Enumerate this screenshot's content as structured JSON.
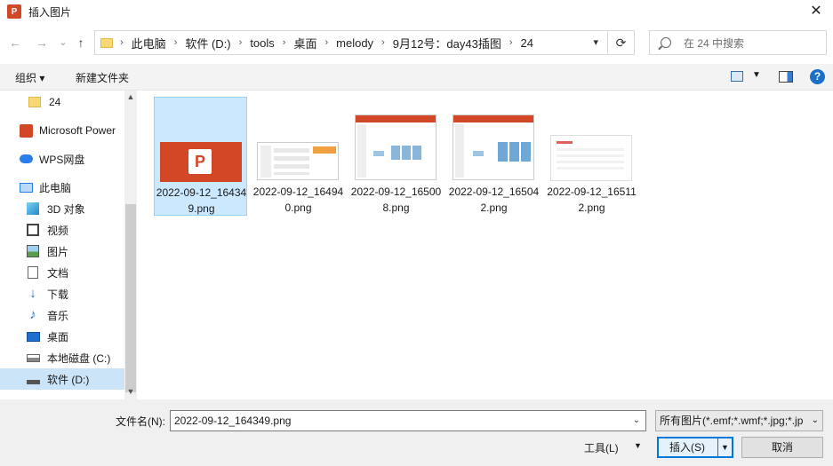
{
  "window": {
    "title": "插入图片",
    "app_icon_letter": "P",
    "close_glyph": "✕"
  },
  "nav": {
    "back_glyph": "←",
    "forward_glyph": "→",
    "recent_glyph": "⌄",
    "up_glyph": "↑",
    "breadcrumbs": [
      "此电脑",
      "软件 (D:)",
      "tools",
      "桌面",
      "melody",
      "9月12号：day43插图",
      "24"
    ],
    "crumb_separator": "›",
    "refresh_glyph": "⟳",
    "search_placeholder": "在 24 中搜索"
  },
  "toolbar": {
    "organize_label": "组织 ▾",
    "new_folder_label": "新建文件夹"
  },
  "sidebar": {
    "items": [
      {
        "label": "24",
        "icon": "folder-icon"
      },
      {
        "label": "Microsoft Power",
        "icon": "powerpoint-icon"
      },
      {
        "label": "WPS网盘",
        "icon": "cloud-icon"
      },
      {
        "label": "此电脑",
        "icon": "computer-icon"
      },
      {
        "label": "3D 对象",
        "icon": "cube-icon"
      },
      {
        "label": "视频",
        "icon": "video-icon"
      },
      {
        "label": "图片",
        "icon": "pictures-icon"
      },
      {
        "label": "文档",
        "icon": "documents-icon"
      },
      {
        "label": "下载",
        "icon": "download-icon"
      },
      {
        "label": "音乐",
        "icon": "music-icon"
      },
      {
        "label": "桌面",
        "icon": "desktop-icon"
      },
      {
        "label": "本地磁盘 (C:)",
        "icon": "drive-c-icon"
      },
      {
        "label": "软件 (D:)",
        "icon": "drive-d-icon"
      }
    ],
    "selected": "软件 (D:)"
  },
  "files": [
    {
      "name": "2022-09-12_164349.png",
      "selected": true
    },
    {
      "name": "2022-09-12_164940.png",
      "selected": false
    },
    {
      "name": "2022-09-12_165008.png",
      "selected": false
    },
    {
      "name": "2022-09-12_165042.png",
      "selected": false
    },
    {
      "name": "2022-09-12_165112.png",
      "selected": false
    }
  ],
  "bottom": {
    "filename_label": "文件名(N):",
    "filename_value": "2022-09-12_164349.png",
    "filetype_value": "所有图片(*.emf;*.wmf;*.jpg;*.jp",
    "tools_label": "工具(L)",
    "insert_label": "插入(S)",
    "cancel_label": "取消"
  },
  "colors": {
    "accent": "#0078d7",
    "selection": "#cce8ff",
    "powerpoint": "#d24726"
  }
}
